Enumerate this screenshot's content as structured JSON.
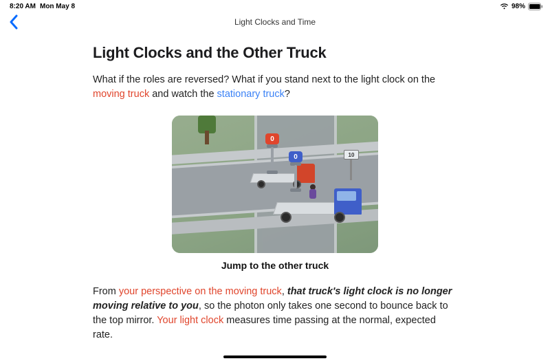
{
  "status": {
    "time": "8:20 AM",
    "date": "Mon May 8",
    "battery_pct": "98%"
  },
  "nav": {
    "title": "Light Clocks and Time"
  },
  "page": {
    "title": "Light Clocks and the Other Truck",
    "p1_a": "What if the roles are reversed? What if you stand next to the light clock on the ",
    "p1_b": "moving truck",
    "p1_c": " and watch the ",
    "p1_d": "stationary truck",
    "p1_e": "?",
    "caption": "Jump to the other truck",
    "p2_a": "From ",
    "p2_b": "your perspective on the moving truck",
    "p2_c": ", ",
    "p2_d": "that truck's light clock is no longer moving relative to you",
    "p2_e": ", so the photon only takes one second to bounce back to the top mirror. ",
    "p2_f": "Your light clock",
    "p2_g": " measures time passing at the normal, expected rate."
  },
  "illus": {
    "sign_value": "10",
    "badge_red": "0",
    "badge_blue": "0"
  }
}
